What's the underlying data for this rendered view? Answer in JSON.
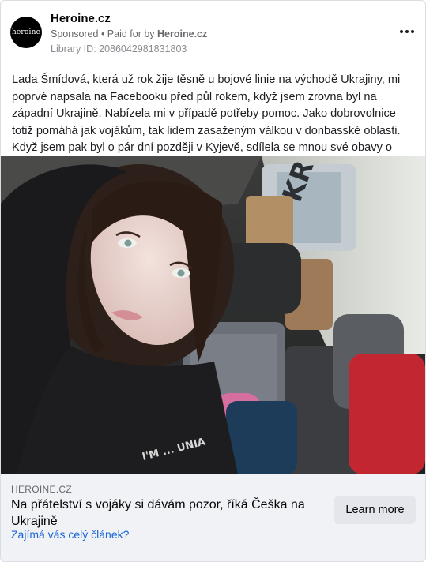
{
  "ad": {
    "page_name": "Heroine.cz",
    "avatar_text": "heroine",
    "sponsored_label": "Sponsored",
    "paid_for_prefix": " • Paid for by ",
    "paid_for_by": "Heroine.cz",
    "library_id": "Library ID: 2086042981831803",
    "more_icon": "more-horizontal-icon"
  },
  "post": {
    "text": "Lada Šmídová, která už rok žije těsně u bojové linie na východě Ukrajiny, mi poprvé napsala na Facebooku před půl rokem, když jsem zrovna byl na západní Ukrajině. Nabízela mi v případě potřeby pomoc. Jako dobrovolnice totiž pomáhá jak vojákům, tak lidem zasaženým válkou v donbasské oblasti. Když jsem pak byl o pár dní později v Kyjevě, sdílela se mnou své obavy o svého blízkého člověka.",
    "image_overlay_text": "I'M ... UNIA"
  },
  "link_preview": {
    "domain": "HEROINE.CZ",
    "headline": "Na přátelství s vojáky si dávám pozor, říká Češka na Ukrajině",
    "link_text": "Zajímá vás celý článek?",
    "button_label": "Learn more"
  }
}
